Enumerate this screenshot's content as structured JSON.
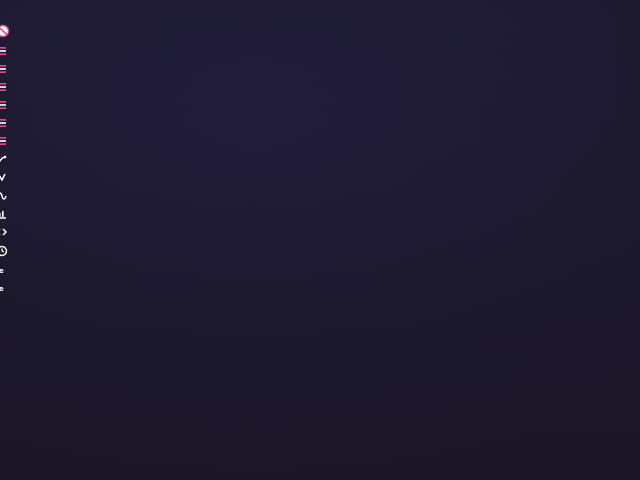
{
  "theme": {
    "background": "#1f1b33",
    "accent": "#e8488a",
    "icon_color": "#ffffff"
  },
  "toolbar": {
    "items": [
      {
        "icon": "no-entry-icon"
      },
      {
        "icon": "list-icon"
      },
      {
        "icon": "list-icon"
      },
      {
        "icon": "list-icon"
      },
      {
        "icon": "list-icon"
      },
      {
        "icon": "list-icon"
      },
      {
        "icon": "list-icon"
      },
      {
        "icon": "curve-icon"
      },
      {
        "icon": "curve-icon"
      },
      {
        "icon": "wave-icon"
      },
      {
        "icon": "chart-icon"
      },
      {
        "icon": "code-icon"
      },
      {
        "icon": "clock-icon"
      },
      {
        "label": "ue"
      },
      {
        "label": "ue"
      }
    ]
  }
}
